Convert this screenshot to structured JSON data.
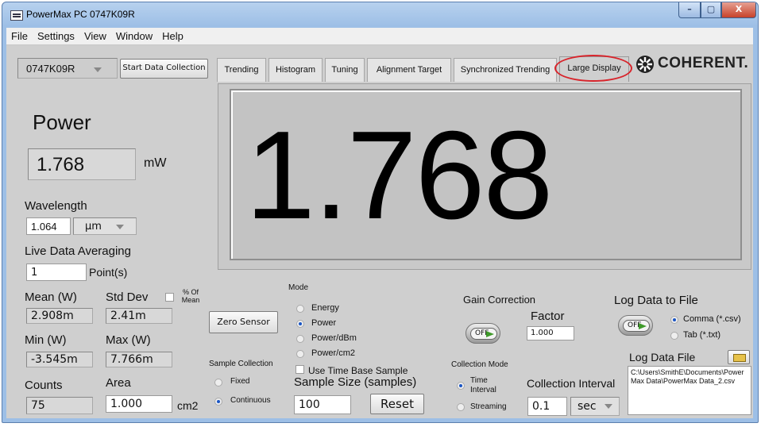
{
  "window": {
    "title": "PowerMax PC  0747K09R",
    "min": "–",
    "max": "▢",
    "close": "X"
  },
  "menu": [
    "File",
    "Settings",
    "View",
    "Window",
    "Help"
  ],
  "device": {
    "serial": "0747K09R",
    "start_btn": "Start Data Collection"
  },
  "tabs": [
    "Trending",
    "Histogram",
    "Tuning",
    "Alignment Target",
    "Synchronized Trending",
    "Large Display"
  ],
  "brand": {
    "name": "COHERENT."
  },
  "big_value": "1.768",
  "left": {
    "power_label": "Power",
    "power_value": "1.768",
    "power_unit": "mW",
    "wavelength_label": "Wavelength",
    "wavelength_value": "1.064",
    "wavelength_unit": "µm",
    "averaging_label": "Live Data Averaging",
    "averaging_value": "1",
    "averaging_unit": "Point(s)",
    "mean_label": "Mean (W)",
    "mean_value": "2.908m",
    "std_label": "Std Dev",
    "std_value": "2.41m",
    "pct_label": "% Of Mean",
    "min_label": "Min (W)",
    "min_value": "-3.545m",
    "max_label": "Max (W)",
    "max_value": "7.766m",
    "counts_label": "Counts",
    "counts_value": "75",
    "area_label": "Area",
    "area_value": "1.000",
    "area_unit": "cm2"
  },
  "controls": {
    "zero_sensor": "Zero Sensor",
    "mode_label": "Mode",
    "modes": [
      "Energy",
      "Power",
      "Power/dBm",
      "Power/cm2"
    ],
    "mode_selected": 1,
    "sample_collection_label": "Sample Collection",
    "sample_collection": [
      "Fixed",
      "Continuous"
    ],
    "use_time_base": "Use Time Base Sample",
    "sample_size_label": "Sample Size (samples)",
    "sample_size_value": "100",
    "reset": "Reset",
    "gain_label": "Gain Correction",
    "gain_toggle": "OFF",
    "factor_label": "Factor",
    "factor_value": "1.000",
    "collection_mode_label": "Collection Mode",
    "collection_modes": [
      "Time Interval",
      "Streaming"
    ],
    "collection_interval_label": "Collection Interval",
    "collection_interval_value": "0.1",
    "collection_interval_unit": "sec",
    "log_label": "Log Data to File",
    "log_toggle": "OFF",
    "log_formats": [
      "Comma (*.csv)",
      "Tab (*.txt)"
    ],
    "log_file_label": "Log Data File",
    "log_file_path": "C:\\Users\\SmithE\\Documents\\PowerMax Data\\PowerMax Data_2.csv"
  },
  "colors": {
    "highlight": "#d8242b",
    "radio": "#1a55c4",
    "toggle_arrow": "#3f9a2a"
  }
}
